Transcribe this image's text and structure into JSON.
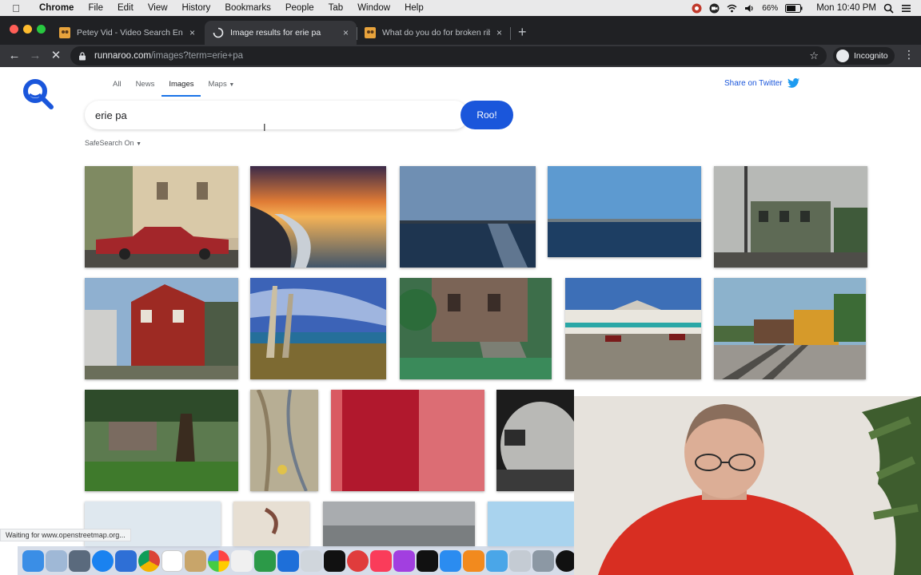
{
  "menubar": {
    "items": [
      "Chrome",
      "File",
      "Edit",
      "View",
      "History",
      "Bookmarks",
      "People",
      "Tab",
      "Window",
      "Help"
    ],
    "battery": "66%",
    "clock": "Mon 10:40 PM"
  },
  "tabs": [
    {
      "title": "Petey Vid - Video Search Engi",
      "close": "×"
    },
    {
      "title": "Image results for erie pa",
      "close": "×"
    },
    {
      "title": "What do you do for broken rib",
      "close": "×"
    }
  ],
  "newtab_label": "+",
  "toolbar": {
    "url_domain": "runnaroo.com",
    "url_path": "/images?term=erie+pa",
    "incognito_label": "Incognito"
  },
  "page": {
    "nav": [
      "All",
      "News",
      "Images",
      "Maps"
    ],
    "search_value": "erie pa",
    "search_button": "Roo!",
    "safesearch": "SafeSearch On",
    "share": "Share on Twitter"
  },
  "status_text": "Waiting for www.openstreetmap.org...",
  "colors": {
    "brand_blue": "#1a56db",
    "chrome_dark": "#202124",
    "chrome_toolbar": "#35363a"
  }
}
